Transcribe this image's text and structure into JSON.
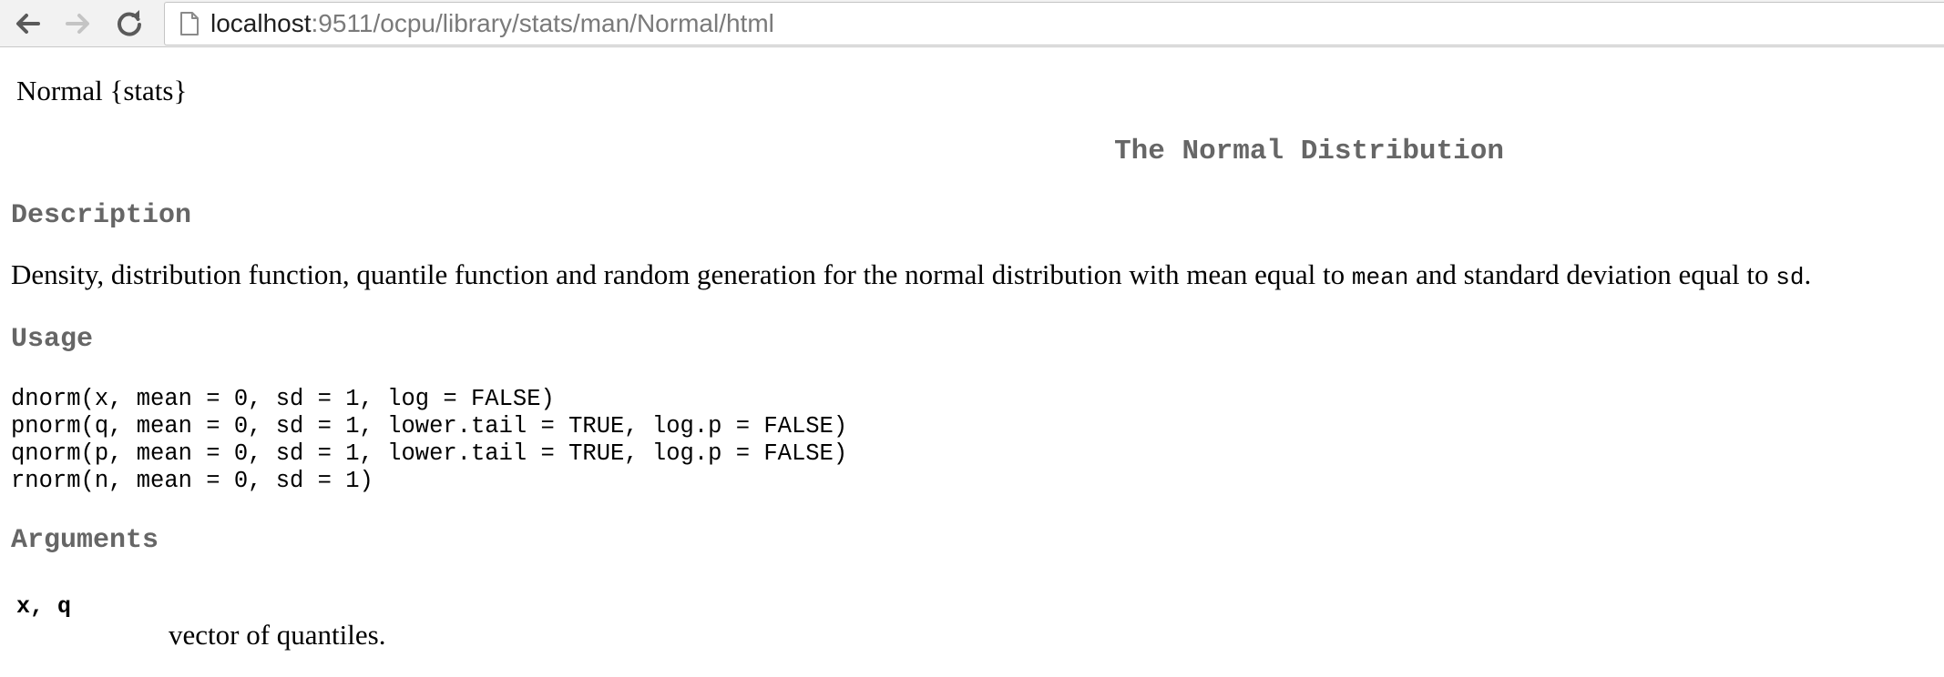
{
  "browser": {
    "url_host": "localhost",
    "url_path": ":9511/ocpu/library/stats/man/Normal/html"
  },
  "page": {
    "header": "Normal {stats}",
    "title": "The Normal Distribution",
    "description_heading": "Description",
    "description": {
      "part1": "Density, distribution function, quantile function and random generation for the normal distribution with mean equal to ",
      "code1": "mean",
      "part2": " and standard deviation equal to ",
      "code2": "sd",
      "part3": "."
    },
    "usage_heading": "Usage",
    "usage_lines": [
      "dnorm(x, mean = 0, sd = 1, log = FALSE)",
      "pnorm(q, mean = 0, sd = 1, lower.tail = TRUE, log.p = FALSE)",
      "qnorm(p, mean = 0, sd = 1, lower.tail = TRUE, log.p = FALSE)",
      "rnorm(n, mean = 0, sd = 1)"
    ],
    "arguments_heading": "Arguments",
    "arguments": [
      {
        "name": "x, q",
        "description": "vector of quantiles."
      }
    ]
  },
  "icons": {
    "back": "back-arrow-icon",
    "forward": "forward-arrow-icon",
    "reload": "reload-icon",
    "page": "page-icon"
  }
}
